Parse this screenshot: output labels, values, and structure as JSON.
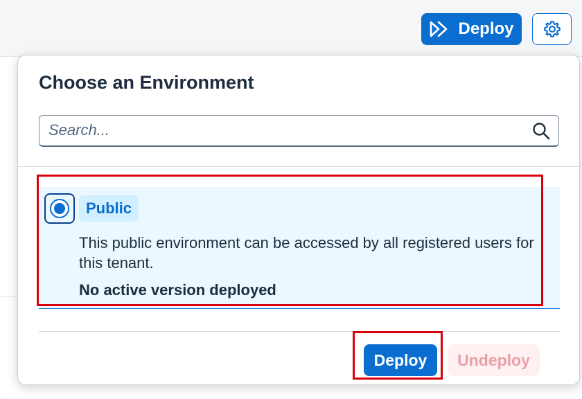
{
  "topbar": {
    "deploy_label": "Deploy",
    "deploy_icon": "deploy-arrows-icon",
    "settings_icon": "gear-icon"
  },
  "popover": {
    "title": "Choose an Environment",
    "search": {
      "placeholder": "Search...",
      "value": ""
    },
    "environments": [
      {
        "name": "Public",
        "selected": true,
        "description": "This public environment can be accessed by all registered users for this tenant.",
        "status": "No active version deployed"
      }
    ],
    "actions": {
      "deploy_label": "Deploy",
      "undeploy_label": "Undeploy"
    }
  },
  "colors": {
    "accent": "#0a6ed1",
    "highlight": "#d9000d",
    "selected_bg": "#ebf8ff",
    "tag_bg": "#d1efff",
    "undeploy_text": "#e8a0a6"
  }
}
